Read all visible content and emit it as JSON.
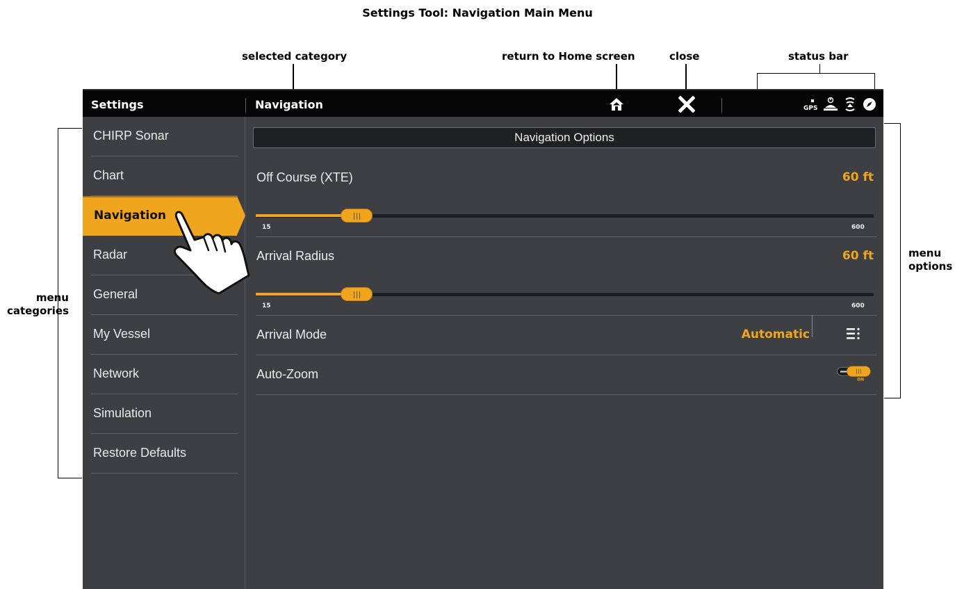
{
  "doc_title": "Settings Tool: Navigation Main Menu",
  "callouts": {
    "selected_category": "selected category",
    "return_home": "return to Home screen",
    "close": "close",
    "status_bar": "status bar",
    "menu_categories": "menu\ncategories",
    "menu_categories_line1": "menu",
    "menu_categories_line2": "categories",
    "menu_options_line1": "menu",
    "menu_options_line2": "options"
  },
  "topbar": {
    "app_title": "Settings",
    "section_title": "Navigation",
    "icons": [
      "home-icon",
      "close-icon",
      "gps-icon",
      "power-alarm-icon",
      "sonar-icon",
      "compass-icon"
    ],
    "gps_label": "GPS"
  },
  "sidebar": {
    "selected": "Navigation",
    "items": [
      {
        "label": "CHIRP Sonar"
      },
      {
        "label": "Chart"
      },
      {
        "label": "Navigation"
      },
      {
        "label": "Radar"
      },
      {
        "label": "General"
      },
      {
        "label": "My Vessel"
      },
      {
        "label": "Network"
      },
      {
        "label": "Simulation"
      },
      {
        "label": "Restore Defaults"
      }
    ]
  },
  "options": {
    "header": "Navigation Options",
    "off_course": {
      "label": "Off Course (XTE)",
      "value": "60 ft",
      "min": "15",
      "max": "600",
      "level": 60
    },
    "arrival_radius": {
      "label": "Arrival Radius",
      "value": "60 ft",
      "min": "15",
      "max": "600",
      "level": 60
    },
    "arrival_mode": {
      "label": "Arrival Mode",
      "value": "Automatic",
      "menu_icon": "list-menu-icon"
    },
    "auto_zoom": {
      "label": "Auto-Zoom",
      "state": "ON"
    }
  },
  "colors": {
    "accent": "#f0a51f",
    "background": "#3d3f42",
    "topbar": "#050505"
  }
}
